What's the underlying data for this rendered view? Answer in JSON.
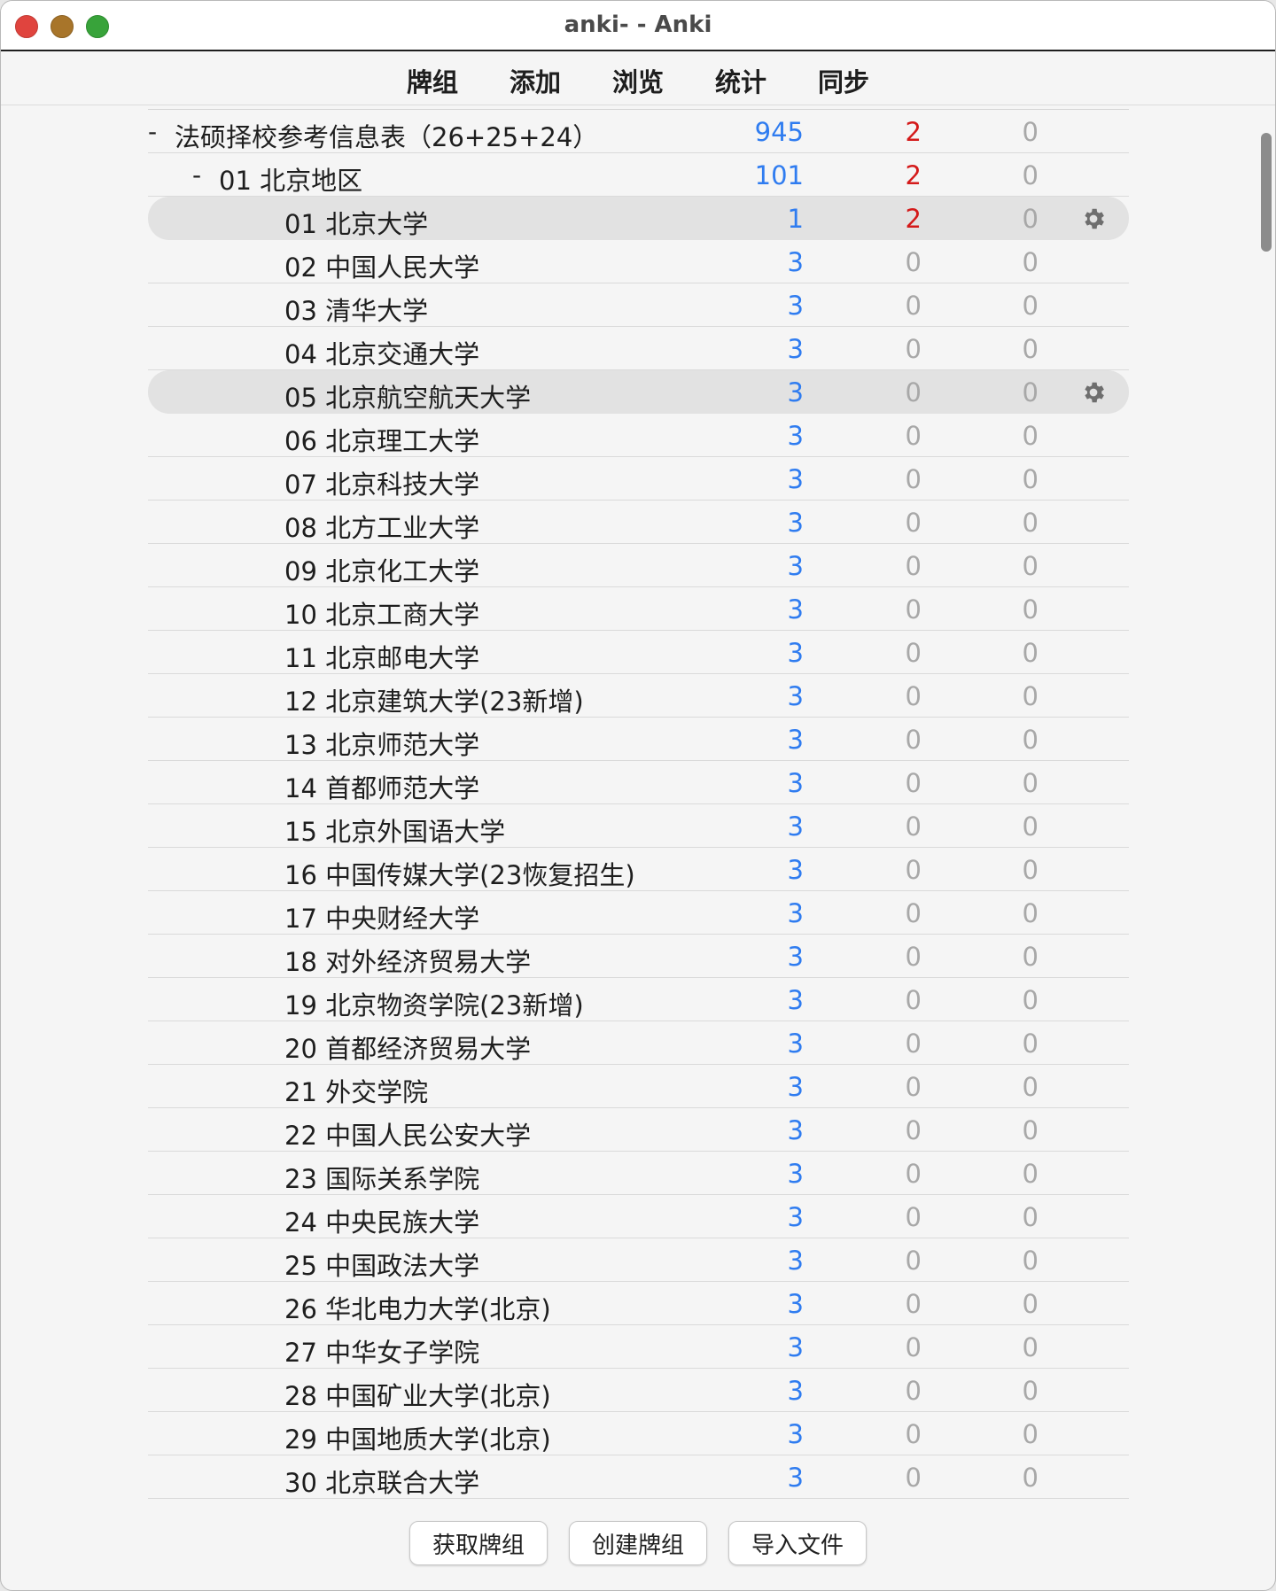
{
  "window": {
    "title": "anki- - Anki",
    "colors": {
      "new": "#2f7cf0",
      "learn": "#d41a1a",
      "zero": "#a8a8a8"
    }
  },
  "toolbar": {
    "items": [
      "牌组",
      "添加",
      "浏览",
      "统计",
      "同步"
    ]
  },
  "decks": [
    {
      "name": "法硕择校参考信息表（26+25+24）",
      "level": 0,
      "expander": "-",
      "new": "945",
      "learn": "2",
      "review": "0",
      "current": false,
      "gear": false
    },
    {
      "name": "01 北京地区",
      "level": 1,
      "expander": "-",
      "new": "101",
      "learn": "2",
      "review": "0",
      "current": false,
      "gear": false
    },
    {
      "name": "01 北京大学",
      "level": 2,
      "expander": "",
      "new": "1",
      "learn": "2",
      "review": "0",
      "current": true,
      "gear": true
    },
    {
      "name": "02 中国人民大学",
      "level": 2,
      "expander": "",
      "new": "3",
      "learn": "0",
      "review": "0",
      "current": false,
      "gear": false
    },
    {
      "name": "03 清华大学",
      "level": 2,
      "expander": "",
      "new": "3",
      "learn": "0",
      "review": "0",
      "current": false,
      "gear": false
    },
    {
      "name": "04 北京交通大学",
      "level": 2,
      "expander": "",
      "new": "3",
      "learn": "0",
      "review": "0",
      "current": false,
      "gear": false
    },
    {
      "name": "05 北京航空航天大学",
      "level": 2,
      "expander": "",
      "new": "3",
      "learn": "0",
      "review": "0",
      "current": true,
      "gear": true
    },
    {
      "name": "06 北京理工大学",
      "level": 2,
      "expander": "",
      "new": "3",
      "learn": "0",
      "review": "0",
      "current": false,
      "gear": false
    },
    {
      "name": "07 北京科技大学",
      "level": 2,
      "expander": "",
      "new": "3",
      "learn": "0",
      "review": "0",
      "current": false,
      "gear": false
    },
    {
      "name": "08 北方工业大学",
      "level": 2,
      "expander": "",
      "new": "3",
      "learn": "0",
      "review": "0",
      "current": false,
      "gear": false
    },
    {
      "name": "09 北京化工大学",
      "level": 2,
      "expander": "",
      "new": "3",
      "learn": "0",
      "review": "0",
      "current": false,
      "gear": false
    },
    {
      "name": "10 北京工商大学",
      "level": 2,
      "expander": "",
      "new": "3",
      "learn": "0",
      "review": "0",
      "current": false,
      "gear": false
    },
    {
      "name": "11 北京邮电大学",
      "level": 2,
      "expander": "",
      "new": "3",
      "learn": "0",
      "review": "0",
      "current": false,
      "gear": false
    },
    {
      "name": "12 北京建筑大学(23新增)",
      "level": 2,
      "expander": "",
      "new": "3",
      "learn": "0",
      "review": "0",
      "current": false,
      "gear": false
    },
    {
      "name": "13 北京师范大学",
      "level": 2,
      "expander": "",
      "new": "3",
      "learn": "0",
      "review": "0",
      "current": false,
      "gear": false
    },
    {
      "name": "14 首都师范大学",
      "level": 2,
      "expander": "",
      "new": "3",
      "learn": "0",
      "review": "0",
      "current": false,
      "gear": false
    },
    {
      "name": "15 北京外国语大学",
      "level": 2,
      "expander": "",
      "new": "3",
      "learn": "0",
      "review": "0",
      "current": false,
      "gear": false
    },
    {
      "name": "16 中国传媒大学(23恢复招生)",
      "level": 2,
      "expander": "",
      "new": "3",
      "learn": "0",
      "review": "0",
      "current": false,
      "gear": false
    },
    {
      "name": "17 中央财经大学",
      "level": 2,
      "expander": "",
      "new": "3",
      "learn": "0",
      "review": "0",
      "current": false,
      "gear": false
    },
    {
      "name": "18 对外经济贸易大学",
      "level": 2,
      "expander": "",
      "new": "3",
      "learn": "0",
      "review": "0",
      "current": false,
      "gear": false
    },
    {
      "name": "19 北京物资学院(23新增)",
      "level": 2,
      "expander": "",
      "new": "3",
      "learn": "0",
      "review": "0",
      "current": false,
      "gear": false
    },
    {
      "name": "20 首都经济贸易大学",
      "level": 2,
      "expander": "",
      "new": "3",
      "learn": "0",
      "review": "0",
      "current": false,
      "gear": false
    },
    {
      "name": "21 外交学院",
      "level": 2,
      "expander": "",
      "new": "3",
      "learn": "0",
      "review": "0",
      "current": false,
      "gear": false
    },
    {
      "name": "22 中国人民公安大学",
      "level": 2,
      "expander": "",
      "new": "3",
      "learn": "0",
      "review": "0",
      "current": false,
      "gear": false
    },
    {
      "name": "23 国际关系学院",
      "level": 2,
      "expander": "",
      "new": "3",
      "learn": "0",
      "review": "0",
      "current": false,
      "gear": false
    },
    {
      "name": "24 中央民族大学",
      "level": 2,
      "expander": "",
      "new": "3",
      "learn": "0",
      "review": "0",
      "current": false,
      "gear": false
    },
    {
      "name": "25 中国政法大学",
      "level": 2,
      "expander": "",
      "new": "3",
      "learn": "0",
      "review": "0",
      "current": false,
      "gear": false
    },
    {
      "name": "26 华北电力大学(北京)",
      "level": 2,
      "expander": "",
      "new": "3",
      "learn": "0",
      "review": "0",
      "current": false,
      "gear": false
    },
    {
      "name": "27 中华女子学院",
      "level": 2,
      "expander": "",
      "new": "3",
      "learn": "0",
      "review": "0",
      "current": false,
      "gear": false
    },
    {
      "name": "28 中国矿业大学(北京)",
      "level": 2,
      "expander": "",
      "new": "3",
      "learn": "0",
      "review": "0",
      "current": false,
      "gear": false
    },
    {
      "name": "29 中国地质大学(北京)",
      "level": 2,
      "expander": "",
      "new": "3",
      "learn": "0",
      "review": "0",
      "current": false,
      "gear": false
    },
    {
      "name": "30 北京联合大学",
      "level": 2,
      "expander": "",
      "new": "3",
      "learn": "0",
      "review": "0",
      "current": false,
      "gear": false
    }
  ],
  "footer": {
    "get_shared": "获取牌组",
    "create_deck": "创建牌组",
    "import_file": "导入文件"
  }
}
